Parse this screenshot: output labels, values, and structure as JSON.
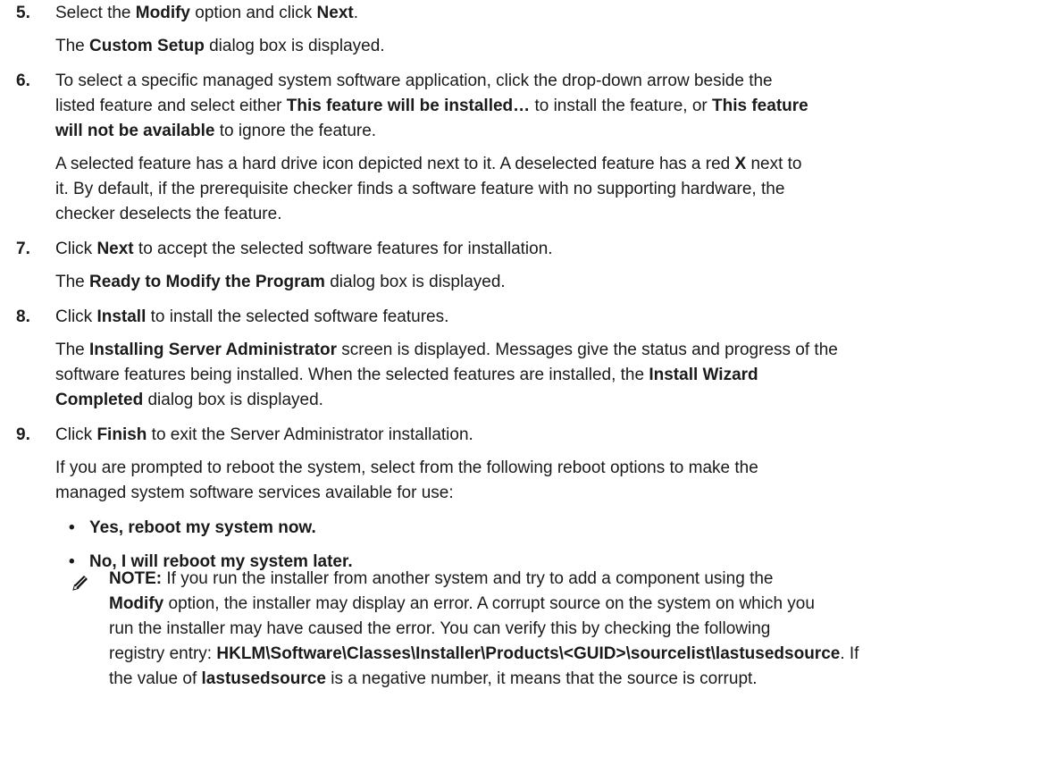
{
  "steps": [
    {
      "number": "5.",
      "lines": [
        [
          {
            "t": "Select the "
          },
          {
            "t": "Modify",
            "b": true
          },
          {
            "t": " option and click "
          },
          {
            "t": "Next",
            "b": true
          },
          {
            "t": "."
          }
        ],
        [
          {
            "t": "The "
          },
          {
            "t": "Custom Setup",
            "b": true
          },
          {
            "t": " dialog box is displayed."
          }
        ]
      ]
    },
    {
      "number": "6.",
      "lines": [
        [
          {
            "t": "To select a specific managed system software application, click the drop-down arrow beside the"
          }
        ],
        [
          {
            "t": "listed feature and select either "
          },
          {
            "t": "This feature will be installed…",
            "b": true
          },
          {
            "t": " to install the feature, or "
          },
          {
            "t": "This feature",
            "b": true
          }
        ],
        [
          {
            "t": "will not be available",
            "b": true
          },
          {
            "t": " to ignore the feature."
          }
        ],
        [
          {
            "t": "A selected feature has a hard drive icon depicted next to it. A deselected feature has a red "
          },
          {
            "t": "X",
            "b": true
          },
          {
            "t": " next to"
          }
        ],
        [
          {
            "t": "it. By default, if the prerequisite checker finds a software feature with no supporting hardware, the"
          }
        ],
        [
          {
            "t": "checker deselects the feature."
          }
        ]
      ]
    },
    {
      "number": "7.",
      "lines": [
        [
          {
            "t": "Click "
          },
          {
            "t": "Next",
            "b": true
          },
          {
            "t": " to accept the selected software features for installation."
          }
        ],
        [
          {
            "t": "The "
          },
          {
            "t": "Ready to Modify the Program",
            "b": true
          },
          {
            "t": " dialog box is displayed."
          }
        ]
      ]
    },
    {
      "number": "8.",
      "lines": [
        [
          {
            "t": "Click "
          },
          {
            "t": "Install",
            "b": true
          },
          {
            "t": " to install the selected software features."
          }
        ],
        [
          {
            "t": "The "
          },
          {
            "t": "Installing Server Administrator",
            "b": true
          },
          {
            "t": " screen is displayed. Messages give the status and progress of the"
          }
        ],
        [
          {
            "t": "software features being installed. When the selected features are installed, the "
          },
          {
            "t": "Install Wizard",
            "b": true
          }
        ],
        [
          {
            "t": "Completed",
            "b": true
          },
          {
            "t": " dialog box is displayed."
          }
        ]
      ]
    },
    {
      "number": "9.",
      "lines": [
        [
          {
            "t": "Click "
          },
          {
            "t": "Finish",
            "b": true
          },
          {
            "t": " to exit the Server Administrator installation."
          }
        ],
        [
          {
            "t": "If you are prompted to reboot the system, select from the following reboot options to make the"
          }
        ],
        [
          {
            "t": "managed system software services available for use:"
          }
        ]
      ]
    }
  ],
  "bullet_char": "•",
  "bullets": [
    "Yes, reboot my system now.",
    "No, I will reboot my system later."
  ],
  "note": {
    "icon": "note-pencil-icon",
    "lines": [
      [
        {
          "t": "NOTE:",
          "b": true
        },
        {
          "t": " If you run the installer from another system and try to add a component using the"
        }
      ],
      [
        {
          "t": "Modify",
          "b": true
        },
        {
          "t": " option, the installer may display an error. A corrupt source on the system on which you"
        }
      ],
      [
        {
          "t": "run the installer may have caused the error. You can verify this by checking the following"
        }
      ],
      [
        {
          "t": "registry entry: "
        },
        {
          "t": "HKLM\\Software\\Classes\\Installer\\Products\\<GUID>\\sourcelist\\lastusedsource",
          "b": true
        },
        {
          "t": ". If"
        }
      ],
      [
        {
          "t": "the value of "
        },
        {
          "t": "lastusedsource",
          "b": true
        },
        {
          "t": " is a negative number, it means that the source is corrupt."
        }
      ]
    ]
  }
}
